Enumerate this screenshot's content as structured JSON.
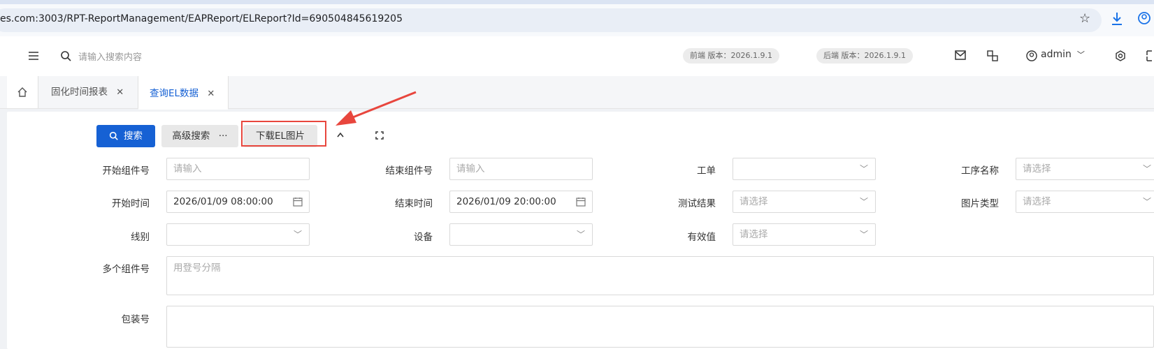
{
  "browser": {
    "url": "es.com:3003/RPT-ReportManagement/EAPReport/ELReport?Id=690504845619205",
    "star_icon": "star-icon",
    "download_icon": "download-icon",
    "account_icon": "account-icon"
  },
  "header": {
    "search_placeholder": "请输入搜索内容",
    "frontend_version": "前端 版本：2026.1.9.1",
    "backend_version": "后端 版本：2026.1.9.1",
    "user": "admin"
  },
  "tabs": [
    {
      "label": "固化时间报表",
      "close": "✕"
    },
    {
      "label": "查询EL数据",
      "close": "✕",
      "active": true
    }
  ],
  "toolbar": {
    "search_label": "搜索",
    "advanced_label": "高级搜索",
    "advanced_more": "···",
    "download_label": "下载EL图片"
  },
  "form": {
    "start_component_label": "开始组件号",
    "start_component_placeholder": "请输入",
    "end_component_label": "结束组件号",
    "end_component_placeholder": "请输入",
    "work_order_label": "工单",
    "work_order_value": "",
    "process_name_label": "工序名称",
    "process_name_placeholder": "请选择",
    "start_time_label": "开始时间",
    "start_time_value": "2026/01/09 08:00:00",
    "end_time_label": "结束时间",
    "end_time_value": "2026/01/09 20:00:00",
    "test_result_label": "测试结果",
    "test_result_placeholder": "请选择",
    "image_type_label": "图片类型",
    "image_type_placeholder": "请选择",
    "line_label": "线别",
    "line_value": "",
    "device_label": "设备",
    "device_value": "",
    "valid_label": "有效值",
    "valid_placeholder": "请选择",
    "multi_component_label": "多个组件号",
    "multi_component_placeholder": "用登号分隔",
    "package_label": "包装号"
  },
  "colors": {
    "primary": "#1661d4",
    "highlight": "#e8463d"
  }
}
